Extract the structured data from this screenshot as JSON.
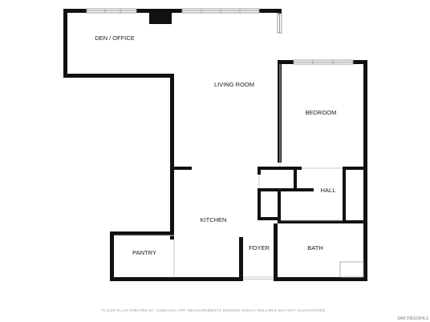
{
  "plan": {
    "rooms": [
      {
        "id": "den",
        "label": "DEN / OFFICE"
      },
      {
        "id": "living",
        "label": "LIVING ROOM"
      },
      {
        "id": "bedroom",
        "label": "BEDROOM"
      },
      {
        "id": "hall",
        "label": "HALL"
      },
      {
        "id": "kitchen",
        "label": "KITCHEN"
      },
      {
        "id": "pantry",
        "label": "PANTRY"
      },
      {
        "id": "foyer",
        "label": "FOYER"
      },
      {
        "id": "bath",
        "label": "BATH"
      }
    ],
    "colors": {
      "wall": "#111111",
      "window": "#9a9a9a",
      "door": "#c8c8c8"
    }
  },
  "footer": {
    "disclaimer": "FLOOR PLAN CREATED BY CUBICASA APP. MEASUREMENTS DEEMED HIGHLY RELIABLE BUT NOT GUARANTEED.",
    "corner_text": "SAN DIEGO|HLS"
  }
}
